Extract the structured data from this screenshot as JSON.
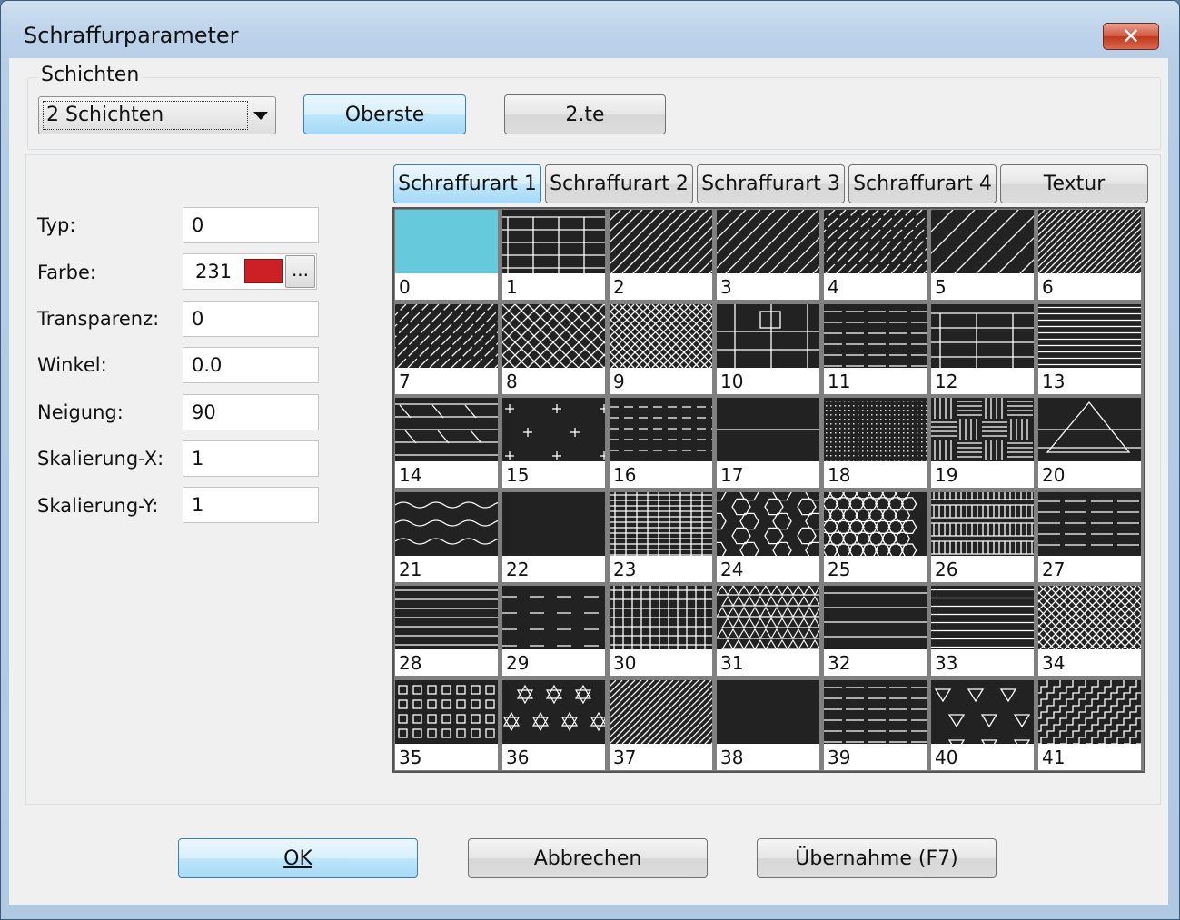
{
  "window": {
    "title": "Schraffurparameter",
    "close_glyph": "✕"
  },
  "layers": {
    "group_label": "Schichten",
    "combo_value": "2 Schichten",
    "top_button": "Oberste",
    "second_button": "2.te"
  },
  "properties": [
    {
      "label": "Typ:",
      "value": "0"
    },
    {
      "label": "Farbe:",
      "value": "231"
    },
    {
      "label": "Transparenz:",
      "value": "0"
    },
    {
      "label": "Winkel:",
      "value": "0.0"
    },
    {
      "label": "Neigung:",
      "value": "90"
    },
    {
      "label": "Skalierung-X:",
      "value": "1"
    },
    {
      "label": "Skalierung-Y:",
      "value": "1"
    }
  ],
  "color": {
    "swatch": "#cc1f26",
    "more_label": "..."
  },
  "tabs": [
    "Schraffurart 1",
    "Schraffurart 2",
    "Schraffurart 3",
    "Schraffurart 4",
    "Textur"
  ],
  "active_tab": 0,
  "patterns": [
    {
      "num": "0",
      "kind": "solid"
    },
    {
      "num": "1",
      "kind": "brick"
    },
    {
      "num": "2",
      "kind": "diag"
    },
    {
      "num": "3",
      "kind": "diag2"
    },
    {
      "num": "4",
      "kind": "diag-dash"
    },
    {
      "num": "5",
      "kind": "diag-wide"
    },
    {
      "num": "6",
      "kind": "diag-dense"
    },
    {
      "num": "7",
      "kind": "diag-dash"
    },
    {
      "num": "8",
      "kind": "cross"
    },
    {
      "num": "9",
      "kind": "cross-dense"
    },
    {
      "num": "10",
      "kind": "blocks"
    },
    {
      "num": "11",
      "kind": "hdash"
    },
    {
      "num": "12",
      "kind": "brick2"
    },
    {
      "num": "13",
      "kind": "hlines"
    },
    {
      "num": "14",
      "kind": "hlines-slash"
    },
    {
      "num": "15",
      "kind": "plus"
    },
    {
      "num": "16",
      "kind": "hdash2"
    },
    {
      "num": "17",
      "kind": "hwide"
    },
    {
      "num": "18",
      "kind": "dots"
    },
    {
      "num": "19",
      "kind": "weave"
    },
    {
      "num": "20",
      "kind": "triangle"
    },
    {
      "num": "21",
      "kind": "wave"
    },
    {
      "num": "22",
      "kind": "empty"
    },
    {
      "num": "23",
      "kind": "grid-dense"
    },
    {
      "num": "24",
      "kind": "hex"
    },
    {
      "num": "25",
      "kind": "hex2"
    },
    {
      "num": "26",
      "kind": "weave2"
    },
    {
      "num": "27",
      "kind": "hdash3"
    },
    {
      "num": "28",
      "kind": "hlines2"
    },
    {
      "num": "29",
      "kind": "hdash4"
    },
    {
      "num": "30",
      "kind": "grid"
    },
    {
      "num": "31",
      "kind": "tri-grid"
    },
    {
      "num": "32",
      "kind": "hlines3"
    },
    {
      "num": "33",
      "kind": "hlines4"
    },
    {
      "num": "34",
      "kind": "cross-dense"
    },
    {
      "num": "35",
      "kind": "squares"
    },
    {
      "num": "36",
      "kind": "stars"
    },
    {
      "num": "37",
      "kind": "diag-dense"
    },
    {
      "num": "38",
      "kind": "empty"
    },
    {
      "num": "39",
      "kind": "hdash"
    },
    {
      "num": "40",
      "kind": "tri-down"
    },
    {
      "num": "41",
      "kind": "stairs"
    }
  ],
  "buttons": {
    "ok": "OK",
    "cancel": "Abbrechen",
    "apply": "Übernahme (F7)"
  }
}
